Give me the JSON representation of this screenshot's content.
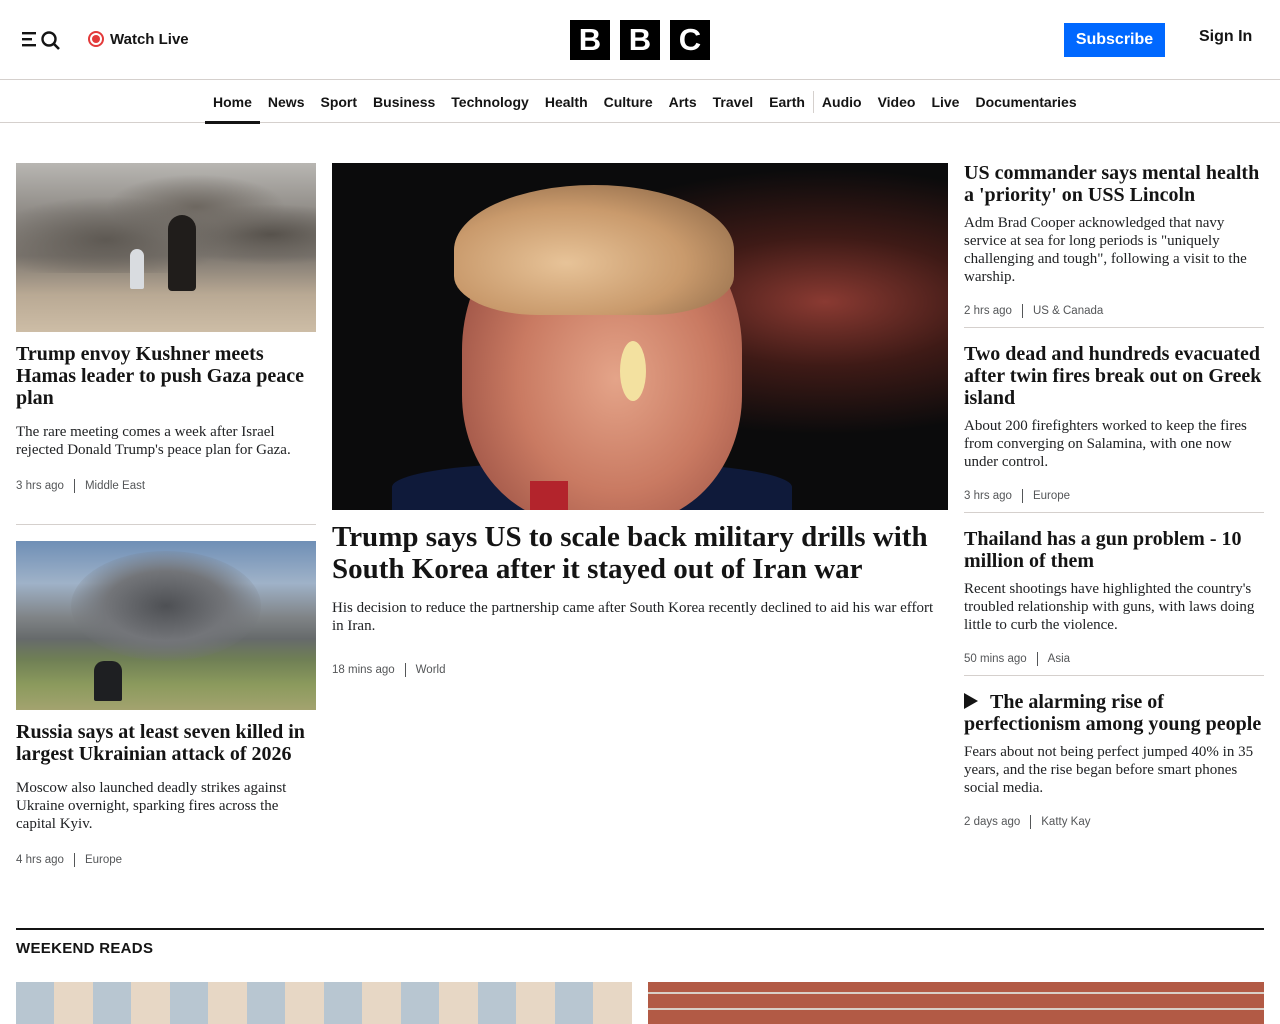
{
  "header": {
    "watch_live": "Watch Live",
    "logo_letters": [
      "B",
      "B",
      "C"
    ],
    "subscribe": "Subscribe",
    "sign_in": "Sign In"
  },
  "nav": {
    "items": [
      "Home",
      "News",
      "Sport",
      "Business",
      "Technology",
      "Health",
      "Culture",
      "Arts",
      "Travel",
      "Earth",
      "Audio",
      "Video",
      "Live",
      "Documentaries"
    ],
    "active": "Home"
  },
  "stories": {
    "left1": {
      "headline": "Trump envoy Kushner meets Hamas leader to push Gaza peace plan",
      "summary": "The rare meeting comes a week after Israel rejected Donald Trump's peace plan for Gaza.",
      "time": "3 hrs ago",
      "section": "Middle East"
    },
    "left2": {
      "headline": "Russia says at least seven killed in largest Ukrainian attack of 2026",
      "summary": "Moscow also launched deadly strikes against Ukraine overnight, sparking fires across the capital Kyiv.",
      "time": "4 hrs ago",
      "section": "Europe"
    },
    "main": {
      "headline": "Trump says US to scale back military drills with South Korea after it stayed out of Iran war",
      "summary": "His decision to reduce the partnership came after South Korea recently declined to aid his war effort in Iran.",
      "time": "18 mins ago",
      "section": "World"
    },
    "right1": {
      "headline": "US commander says mental health a 'priority' on USS Lincoln",
      "summary": "Adm Brad Cooper acknowledged that navy service at sea for long periods is \"uniquely challenging and tough\", following a visit to the warship.",
      "time": "2 hrs ago",
      "section": "US & Canada"
    },
    "right2": {
      "headline": "Two dead and hundreds evacuated after twin fires break out on Greek island",
      "summary": "About 200 firefighters worked to keep the fires from converging on Salamina, with one now under control.",
      "time": "3 hrs ago",
      "section": "Europe"
    },
    "right3": {
      "headline": "Thailand has a gun problem - 10 million of them",
      "summary": "Recent shootings have highlighted the country's troubled relationship with guns, with laws doing little to curb the violence.",
      "time": "50 mins ago",
      "section": "Asia"
    },
    "right4": {
      "headline": "The alarming rise of perfectionism among young people",
      "summary": "Fears about not being perfect jumped 40% in 35 years, and the rise began before smart phones social media.",
      "time": "2 days ago",
      "section": "Katty Kay"
    }
  },
  "weekend": {
    "title": "WEEKEND READS"
  }
}
